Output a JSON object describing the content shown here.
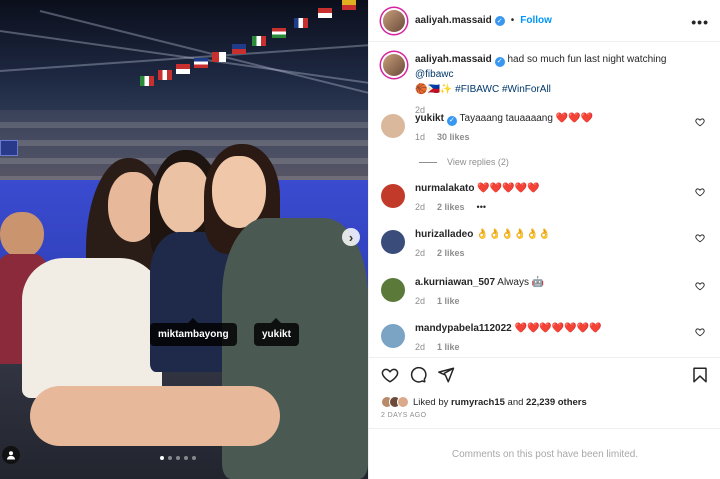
{
  "post": {
    "author": "aaliyah.massaid",
    "follow_label": "Follow",
    "more_label": "•••"
  },
  "photo": {
    "tags": [
      "miktambayong",
      "yukikt"
    ],
    "carousel_dots": 5,
    "active_dot": 0
  },
  "caption": {
    "username": "aaliyah.massaid",
    "text": "had so much fun last night watching",
    "mention": "@fibawc",
    "emoji": "🏀🇵🇭✨",
    "hashtags": "#FIBAWC #WinForAll",
    "time": "2d"
  },
  "comments": [
    {
      "username": "yukikt",
      "verified": true,
      "text": "Tayaaang tauaaaang ❤️❤️❤️",
      "time": "1d",
      "likes": "30 likes",
      "avatar_color": "#d9b89c"
    },
    {
      "username": "nurmalakato",
      "verified": false,
      "text": "❤️❤️❤️❤️❤️",
      "time": "2d",
      "likes": "2 likes",
      "extra": "•••",
      "avatar_color": "#c23a2a"
    },
    {
      "username": "hurizalladeo",
      "verified": false,
      "text": "👌👌👌👌👌👌",
      "time": "2d",
      "likes": "2 likes",
      "avatar_color": "#3a4c7a"
    },
    {
      "username": "a.kurniawan_507",
      "verified": false,
      "text": "Always 🤖",
      "time": "2d",
      "likes": "1 like",
      "avatar_color": "#5b7a3a"
    },
    {
      "username": "mandypabela112022",
      "verified": false,
      "text": "❤️❤️❤️❤️❤️❤️❤️",
      "time": "2d",
      "likes": "1 like",
      "avatar_color": "#7aa3c4"
    }
  ],
  "view_replies": "View replies (2)",
  "likes": {
    "liked_by_prefix": "Liked by",
    "liked_by_user": "rumyrach15",
    "and_others": "and",
    "others_count": "22,239 others"
  },
  "posted_ago": "2 DAYS AGO",
  "comments_limited": "Comments on this post have been limited.",
  "colors": {
    "link_blue": "#0095f6",
    "hashtag": "#00376b",
    "muted": "#8e8e8e",
    "heart_red": "#ed4956"
  }
}
